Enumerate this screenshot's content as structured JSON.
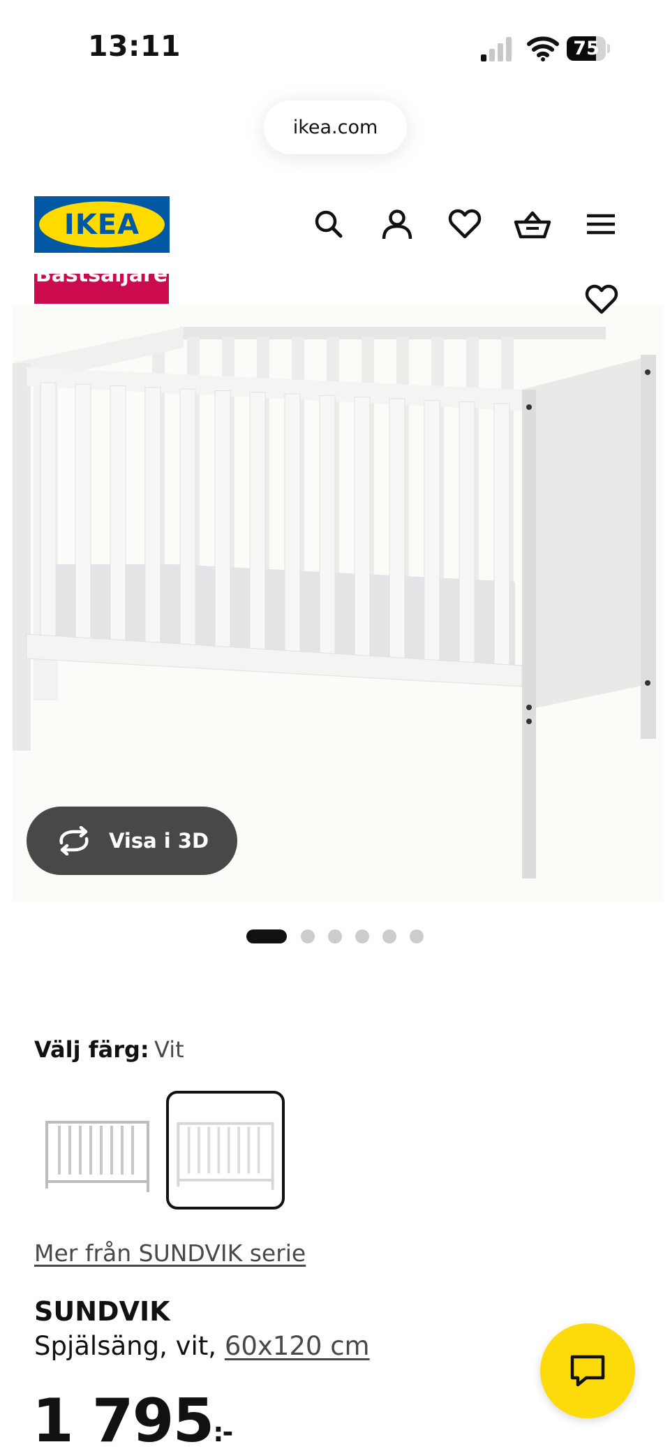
{
  "status_bar": {
    "time": "13:11",
    "battery_level": 75,
    "battery_text": "75"
  },
  "browser": {
    "url": "ikea.com"
  },
  "header": {
    "logo_text": "IKEA",
    "icons": [
      "search-icon",
      "account-icon",
      "heart-icon",
      "basket-icon",
      "menu-icon"
    ]
  },
  "product_image": {
    "badge": "Bästsäljare",
    "view_3d_label": "Visa i 3D",
    "gallery_count": 6,
    "gallery_active_index": 0
  },
  "color_selection": {
    "label": "Välj färg:",
    "value": "Vit",
    "options_count": 2,
    "selected_index": 1
  },
  "product": {
    "series_link": "Mer från SUNDVIK serie",
    "name": "SUNDVIK",
    "description_prefix": "Spjälsäng, vit,",
    "size_link": "60x120 cm",
    "price": "1 795",
    "price_suffix": ":-"
  },
  "colors": {
    "ikea_blue": "#0058a3",
    "ikea_yellow": "#ffdb00",
    "badge_red": "#cc0a4e",
    "button_dark": "#484848",
    "chat_yellow": "#fddb0a"
  }
}
